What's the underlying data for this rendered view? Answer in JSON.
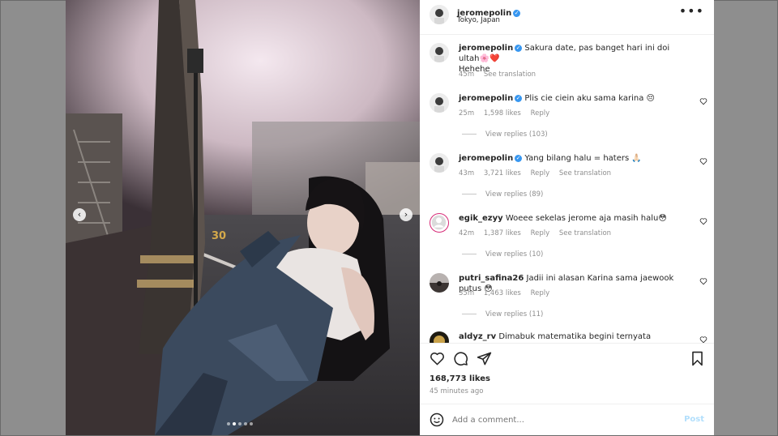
{
  "post": {
    "username": "jeromepolin",
    "location": "Tokyo, Japan",
    "more_icon": "more-horizontal-icon",
    "carousel": {
      "slides": 5,
      "active_index": 1
    }
  },
  "caption": {
    "username": "jeromepolin",
    "text": "Sakura date, pas banget hari ini doi ultah🌸❤️",
    "text2": "Hehehe",
    "time": "45m",
    "see_translation": "See translation"
  },
  "comments": [
    {
      "username": "jeromepolin",
      "verified": true,
      "text": "Plis cie ciein aku sama karina 😔",
      "time": "25m",
      "likes": "1,598 likes",
      "reply": "Reply",
      "translate": "",
      "view_replies": "View replies (103)"
    },
    {
      "username": "jeromepolin",
      "verified": true,
      "text": "Yang bilang halu = haters 🙏🏻",
      "time": "43m",
      "likes": "3,721 likes",
      "reply": "Reply",
      "translate": "See translation",
      "view_replies": "View replies (89)"
    },
    {
      "username": "egik_ezyy",
      "verified": false,
      "text": "Woeee sekelas jerome aja masih halu😳",
      "time": "42m",
      "likes": "1,387 likes",
      "reply": "Reply",
      "translate": "See translation",
      "view_replies": "View replies (10)"
    },
    {
      "username": "putri_safina26",
      "verified": false,
      "text": "Jadii ini alasan Karina sama jaewook putus 😳",
      "time": "35m",
      "likes": "1,463 likes",
      "reply": "Reply",
      "translate": "",
      "view_replies": "View replies (11)"
    },
    {
      "username": "aldyz_rv",
      "verified": false,
      "text": "Dimabuk matematika begini ternyata",
      "time": "",
      "likes": "",
      "reply": "",
      "translate": "",
      "view_replies": ""
    }
  ],
  "footer": {
    "likes": "168,773 likes",
    "time_ago": "45 minutes ago",
    "comment_placeholder": "Add a comment...",
    "post_button": "Post"
  },
  "colors": {
    "verified": "#3897f0",
    "post_disabled": "#b2dffc",
    "text": "#262626",
    "muted": "#8e8e8e"
  }
}
